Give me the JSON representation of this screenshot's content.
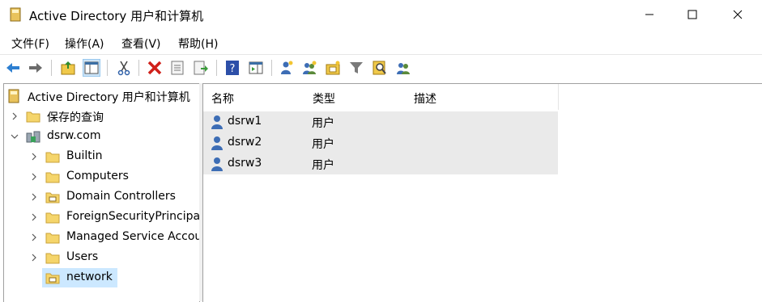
{
  "window": {
    "title": "Active Directory 用户和计算机"
  },
  "menu": [
    {
      "label": "文件(F)"
    },
    {
      "label": "操作(A)"
    },
    {
      "label": "查看(V)"
    },
    {
      "label": "帮助(H)"
    }
  ],
  "toolbar": {
    "icons": [
      "back-arrow-icon",
      "forward-arrow-icon",
      "up-folder-icon",
      "show-hide-tree-icon",
      "cut-icon",
      "delete-icon",
      "properties-icon",
      "export-list-icon",
      "help-icon",
      "action-pane-icon",
      "new-user-icon",
      "new-group-icon",
      "new-ou-icon",
      "filter-icon",
      "find-icon",
      "add-to-group-icon"
    ]
  },
  "tree": {
    "root": "Active Directory 用户和计算机",
    "saved_queries": "保存的查询",
    "domain": "dsrw.com",
    "children": [
      {
        "label": "Builtin",
        "icon": "folder-icon"
      },
      {
        "label": "Computers",
        "icon": "folder-icon"
      },
      {
        "label": "Domain Controllers",
        "icon": "ou-folder-icon"
      },
      {
        "label": "ForeignSecurityPrincipals",
        "icon": "folder-icon"
      },
      {
        "label": "Managed Service Accounts",
        "icon": "folder-icon"
      },
      {
        "label": "Users",
        "icon": "folder-icon"
      },
      {
        "label": "network",
        "icon": "ou-folder-icon",
        "selected": true
      }
    ]
  },
  "list": {
    "columns": [
      "名称",
      "类型",
      "描述"
    ],
    "rows": [
      {
        "name": "dsrw1",
        "type": "用户",
        "desc": ""
      },
      {
        "name": "dsrw2",
        "type": "用户",
        "desc": ""
      },
      {
        "name": "dsrw3",
        "type": "用户",
        "desc": ""
      }
    ]
  },
  "colors": {
    "selection": "#cce8ff",
    "row_bg": "#eaeaea",
    "folder": "#f5d56b"
  }
}
